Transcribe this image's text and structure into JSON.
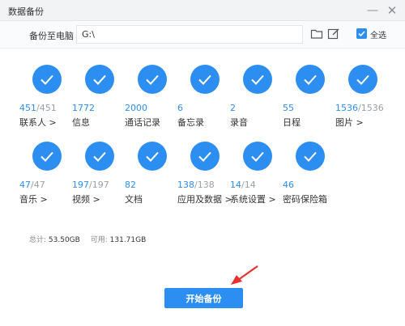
{
  "window": {
    "title": "数据备份",
    "minimize_icon": "minimize-icon",
    "close_icon": "close-icon"
  },
  "toolbar": {
    "backup_label": "备份至电脑",
    "path_value": "G:\\",
    "folder_icon": "folder-icon",
    "edit_icon": "edit-icon",
    "select_all_label": "全选",
    "select_all_checked": true
  },
  "items": [
    {
      "done": "451",
      "total": "/451",
      "label": "联系人 >"
    },
    {
      "done": "1772",
      "total": "",
      "label": "信息"
    },
    {
      "done": "2000",
      "total": "",
      "label": "通话记录"
    },
    {
      "done": "6",
      "total": "",
      "label": "备忘录"
    },
    {
      "done": "2",
      "total": "",
      "label": "录音"
    },
    {
      "done": "55",
      "total": "",
      "label": "日程"
    },
    {
      "done": "1536",
      "total": "/1536",
      "label": "图片 >"
    },
    {
      "done": "47",
      "total": "/47",
      "label": "音乐 >"
    },
    {
      "done": "197",
      "total": "/197",
      "label": "视频 >"
    },
    {
      "done": "82",
      "total": "",
      "label": "文档"
    },
    {
      "done": "138",
      "total": "/138",
      "label": "应用及数据 >"
    },
    {
      "done": "14",
      "total": "/14",
      "label": "系统设置 >"
    },
    {
      "done": "46",
      "total": "",
      "label": "密码保险箱"
    }
  ],
  "summary": {
    "total_label": "总计:",
    "total_value": "53.50GB",
    "available_label": "可用:",
    "available_value": "131.71GB"
  },
  "start_button": "开始备份",
  "colors": {
    "accent": "#2c8ef0",
    "arrow": "#e8302e"
  }
}
